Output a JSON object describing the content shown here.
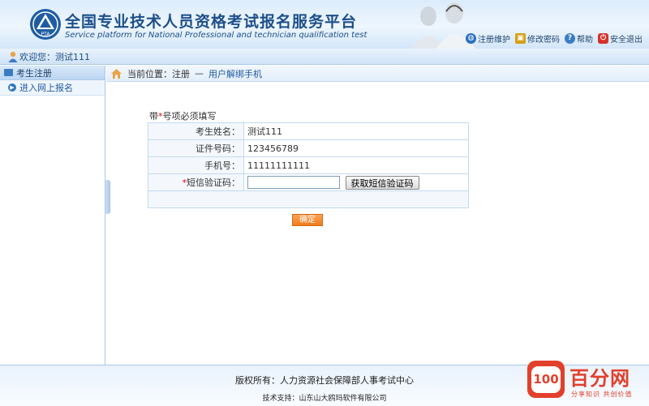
{
  "header": {
    "title_cn": "全国专业技术人员资格考试报名服务平台",
    "title_en": "Service platform for National Professional and technician qualification test",
    "logo_text": "PTA",
    "links": [
      {
        "label": "注册维护",
        "icon": "globe-icon",
        "color": "#2a6fbf"
      },
      {
        "label": "修改密码",
        "icon": "lock-icon",
        "color": "#d4a017"
      },
      {
        "label": "帮助",
        "icon": "help-icon",
        "color": "#3b7dc4"
      },
      {
        "label": "安全退出",
        "icon": "power-icon",
        "color": "#d6322a"
      }
    ]
  },
  "welcome": {
    "text": "欢迎您：测试111"
  },
  "sidebar": {
    "heading": "考生注册",
    "items": [
      {
        "label": "进入网上报名"
      }
    ]
  },
  "breadcrumb": {
    "prefix": "当前位置：注册 ",
    "separator": "—",
    "current": "用户解绑手机"
  },
  "form": {
    "note_prefix": "带",
    "note_star": "*",
    "note_suffix": "号项必须填写",
    "rows": [
      {
        "label": "考生姓名：",
        "value": "测试111"
      },
      {
        "label": "证件号码：",
        "value": "123456789"
      },
      {
        "label": "手机号：",
        "value": "11111111111"
      }
    ],
    "sms": {
      "star": "*",
      "label": "短信验证码：",
      "value": "",
      "button": "获取短信验证码"
    },
    "confirm": "确定"
  },
  "footer": {
    "copyright": "版权所有：人力资源社会保障部人事考试中心",
    "support": "技术支持：山东山大鸥玛软件有限公司"
  },
  "watermark": {
    "badge": "100",
    "name": "百分网",
    "slogan": "分享知识 共创价值"
  },
  "colors": {
    "brand_blue": "#1c4f8a",
    "accent_orange": "#f27a1a",
    "watermark_red": "#e2402b"
  }
}
